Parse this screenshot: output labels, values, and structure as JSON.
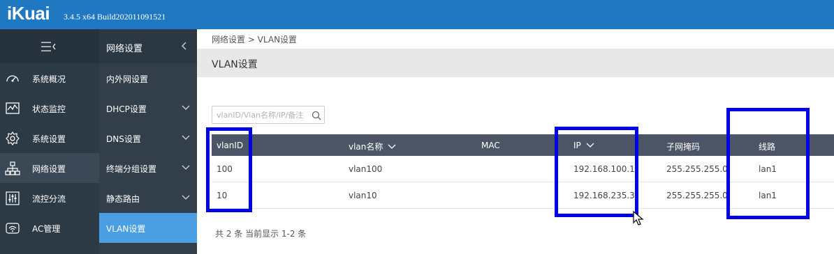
{
  "app": {
    "logo": "iKuai",
    "version": "3.4.5 x64 Build202011091521"
  },
  "sidebar": {
    "items": [
      {
        "label": "系统概况",
        "icon": "dashboard-icon"
      },
      {
        "label": "状态监控",
        "icon": "monitor-chart-icon"
      },
      {
        "label": "系统设置",
        "icon": "gear-icon"
      },
      {
        "label": "网络设置",
        "icon": "network-tree-icon"
      },
      {
        "label": "流控分流",
        "icon": "sliders-icon"
      },
      {
        "label": "AC管理",
        "icon": "wifi-router-icon"
      }
    ]
  },
  "submenu": {
    "title": "网络设置",
    "items": [
      {
        "label": "内外网设置"
      },
      {
        "label": "DHCP设置"
      },
      {
        "label": "DNS设置"
      },
      {
        "label": "终端分组设置"
      },
      {
        "label": "静态路由"
      },
      {
        "label": "VLAN设置"
      }
    ]
  },
  "breadcrumb": "网络设置 > VLAN设置",
  "page_title": "VLAN设置",
  "search": {
    "placeholder": "vlanID/Vlan名称/IP/备注"
  },
  "table": {
    "headers": [
      "vlanID",
      "vlan名称",
      "MAC",
      "IP",
      "子网掩码",
      "线路"
    ],
    "rows": [
      [
        "100",
        "vlan100",
        "",
        "192.168.100.1",
        "255.255.255.0",
        "lan1"
      ],
      [
        "10",
        "vlan10",
        "",
        "192.168.235.3",
        "255.255.255.0",
        "lan1"
      ]
    ]
  },
  "footer": "共 2 条 当前显示 1-2 条",
  "colors": {
    "topbar": "#1f78c1",
    "sidebar": "#2c3a46",
    "submenu": "#323f4b",
    "active_item": "#4a9ee2",
    "table_header": "#4b5566",
    "highlight": "#0000e6"
  }
}
